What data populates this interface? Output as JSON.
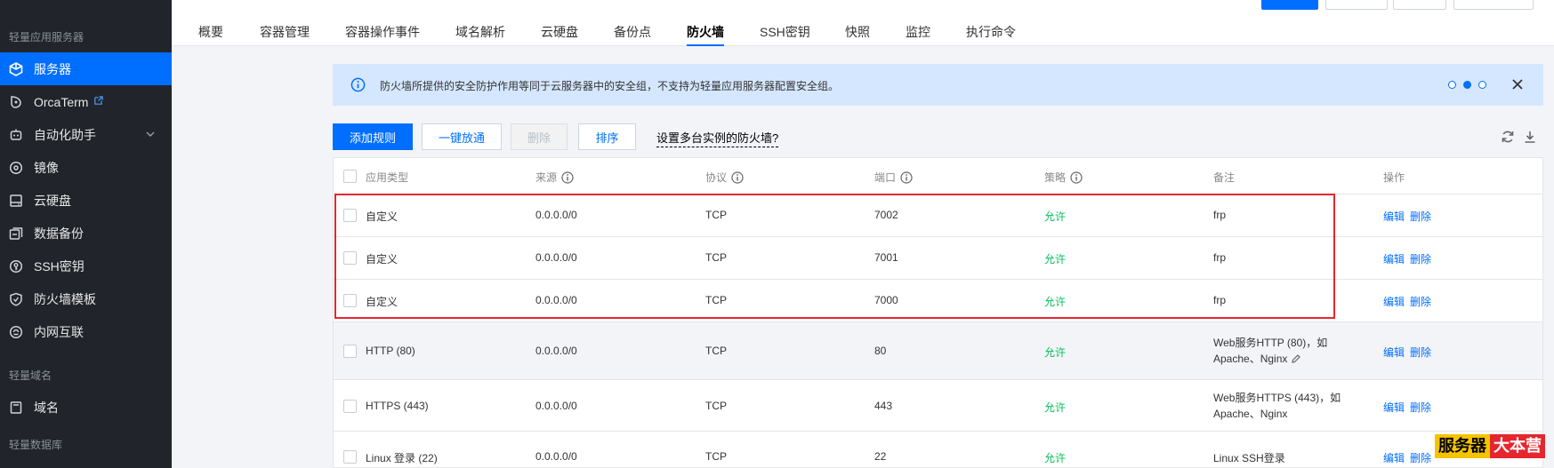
{
  "sidebar": {
    "groups": [
      "轻量应用服务器",
      "轻量域名",
      "轻量数据库"
    ],
    "items": [
      {
        "label": "服务器",
        "icon": "cube-icon",
        "active": true
      },
      {
        "label": "OrcaTerm",
        "icon": "terminal-icon",
        "external": true
      },
      {
        "label": "自动化助手",
        "icon": "robot-icon",
        "expandable": true
      },
      {
        "label": "镜像",
        "icon": "disc-icon"
      },
      {
        "label": "云硬盘",
        "icon": "hard-disk-icon"
      },
      {
        "label": "数据备份",
        "icon": "backup-icon"
      },
      {
        "label": "SSH密钥",
        "icon": "key-icon"
      },
      {
        "label": "防火墙模板",
        "icon": "shield-icon"
      },
      {
        "label": "内网互联",
        "icon": "network-icon"
      },
      {
        "label": "域名",
        "icon": "domain-icon"
      }
    ]
  },
  "tabs": [
    {
      "label": "概要"
    },
    {
      "label": "容器管理"
    },
    {
      "label": "容器操作事件"
    },
    {
      "label": "域名解析"
    },
    {
      "label": "云硬盘"
    },
    {
      "label": "备份点"
    },
    {
      "label": "防火墙",
      "active": true
    },
    {
      "label": "SSH密钥"
    },
    {
      "label": "快照"
    },
    {
      "label": "监控"
    },
    {
      "label": "执行命令"
    }
  ],
  "banner": {
    "message": "防火墙所提供的安全防护作用等同于云服务器中的安全组，不支持为轻量应用服务器配置安全组。",
    "page_index": 2,
    "page_count": 3
  },
  "toolbar": {
    "add_rule": "添加规则",
    "one_click_allow": "一键放通",
    "delete": "删除",
    "sort": "排序",
    "help_link": "设置多台实例的防火墙?"
  },
  "table": {
    "headers": {
      "app_type": "应用类型",
      "source": "来源",
      "protocol": "协议",
      "port": "端口",
      "policy": "策略",
      "remark": "备注",
      "ops": "操作"
    },
    "edit_label": "编辑",
    "delete_label": "删除",
    "rows": [
      {
        "app_type": "自定义",
        "source": "0.0.0.0/0",
        "protocol": "TCP",
        "port": "7002",
        "policy": "允许",
        "remark_line1": "frp",
        "remark_line2": ""
      },
      {
        "app_type": "自定义",
        "source": "0.0.0.0/0",
        "protocol": "TCP",
        "port": "7001",
        "policy": "允许",
        "remark_line1": "frp",
        "remark_line2": ""
      },
      {
        "app_type": "自定义",
        "source": "0.0.0.0/0",
        "protocol": "TCP",
        "port": "7000",
        "policy": "允许",
        "remark_line1": "frp",
        "remark_line2": ""
      },
      {
        "app_type": "HTTP (80)",
        "source": "0.0.0.0/0",
        "protocol": "TCP",
        "port": "80",
        "policy": "允许",
        "remark_line1": "Web服务HTTP (80)，如",
        "remark_line2": "Apache、Nginx"
      },
      {
        "app_type": "HTTPS (443)",
        "source": "0.0.0.0/0",
        "protocol": "TCP",
        "port": "443",
        "policy": "允许",
        "remark_line1": "Web服务HTTPS (443)，如",
        "remark_line2": "Apache、Nginx"
      },
      {
        "app_type": "Linux 登录 (22)",
        "source": "0.0.0.0/0",
        "protocol": "TCP",
        "port": "22",
        "policy": "允许",
        "remark_line1": "Linux SSH登录",
        "remark_line2": ""
      }
    ]
  },
  "watermark": {
    "part1": "服务器",
    "part2": "大本营"
  },
  "colors": {
    "accent": "#006eff",
    "allow": "#0abf5b",
    "highlight": "#e5262e",
    "sidebar_bg": "#21252b",
    "banner_bg": "#d5e7ff"
  }
}
